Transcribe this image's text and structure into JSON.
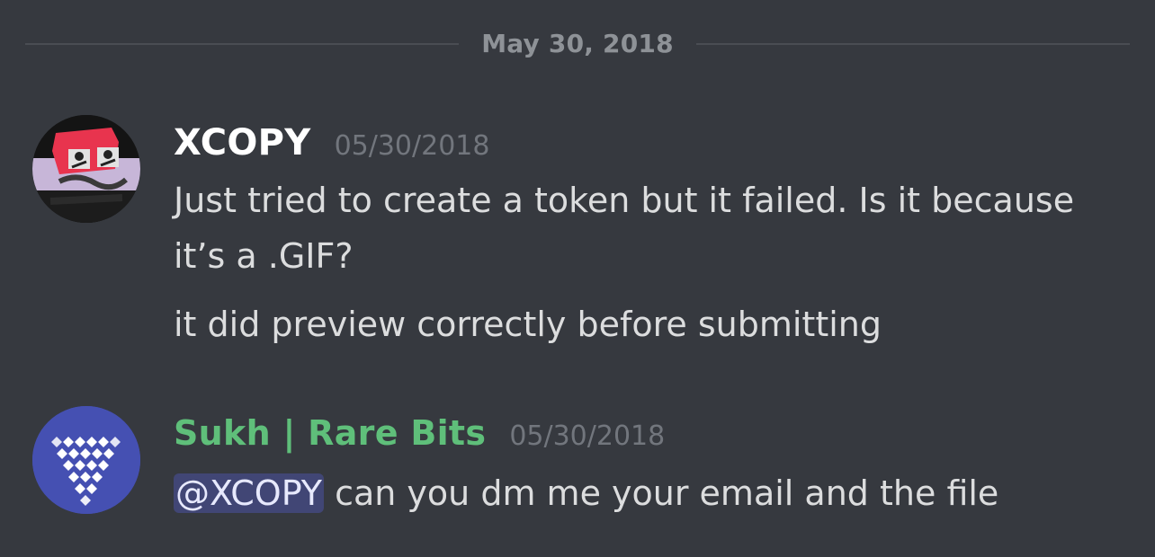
{
  "date_divider": "May 30, 2018",
  "messages": [
    {
      "username": "XCOPY",
      "timestamp": "05/30/2018",
      "lines": [
        "Just tried to create a token but it failed. Is it because",
        "it’s a .GIF?",
        "it did preview correctly before submitting"
      ],
      "avatar_icon": "xcopy-artwork-avatar"
    },
    {
      "username": "Sukh | Rare Bits",
      "username_color": "#5fbf7a",
      "timestamp": "05/30/2018",
      "mention": "@XCOPY",
      "text": " can you dm me your email and the file",
      "avatar_icon": "rare-bits-diamond-logo",
      "avatar_color": "#4550b2"
    }
  ]
}
